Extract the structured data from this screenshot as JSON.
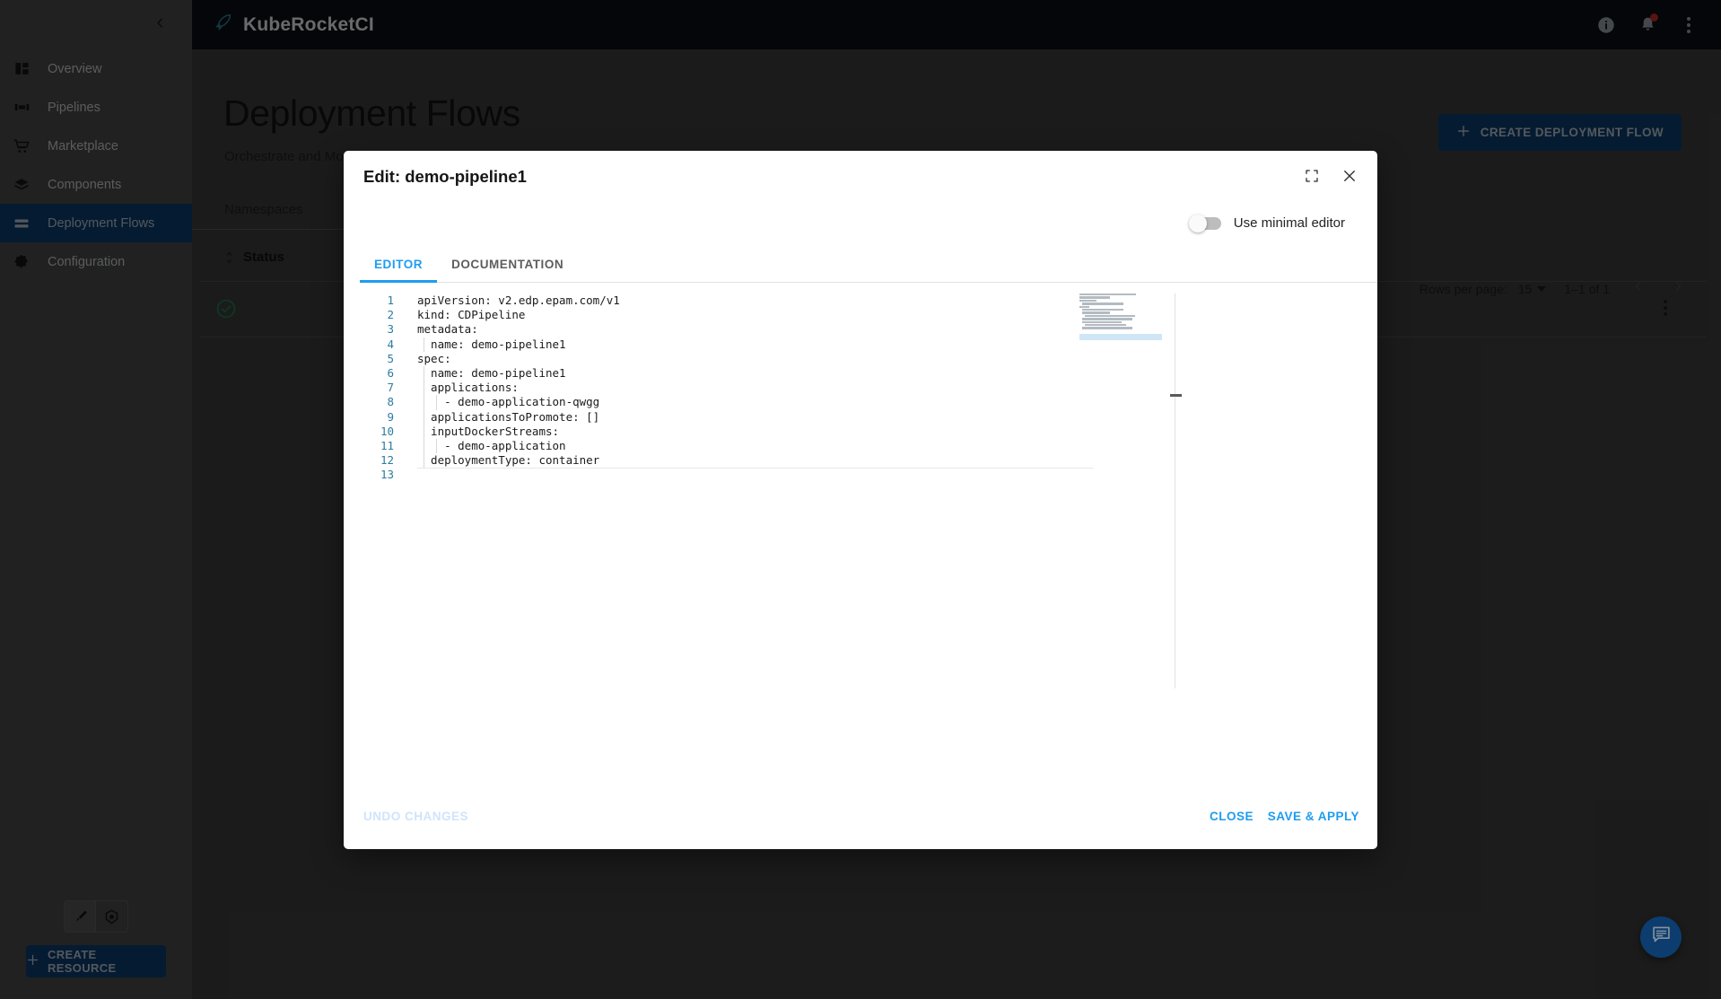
{
  "app": {
    "brand": "KubeRocketCI",
    "logo_icon": "rocket-icon"
  },
  "topbar": {
    "info_icon": "info-icon",
    "notifications_icon": "bell-icon",
    "menu_icon": "kebab-menu-icon",
    "has_notification_badge": true
  },
  "sidebar": {
    "collapse_icon": "chevron-left-icon",
    "items": [
      {
        "label": "Overview",
        "icon": "dashboard-icon",
        "active": false
      },
      {
        "label": "Pipelines",
        "icon": "pipelines-icon",
        "active": false
      },
      {
        "label": "Marketplace",
        "icon": "cart-icon",
        "active": false
      },
      {
        "label": "Components",
        "icon": "layers-icon",
        "active": false
      },
      {
        "label": "Deployment Flows",
        "icon": "flows-icon",
        "active": true
      },
      {
        "label": "Configuration",
        "icon": "gear-icon",
        "active": false
      }
    ],
    "theme_toggle": [
      {
        "icon": "paintbrush-icon",
        "selected": true
      },
      {
        "icon": "kubernetes-icon",
        "selected": false
      }
    ],
    "create_resource_label": "CREATE RESOURCE",
    "create_resource_icon": "plus-icon"
  },
  "main": {
    "title": "Deployment Flows",
    "subtitle": "Orchestrate and Mor",
    "namespaces_label": "Namespaces",
    "create_button_label": "CREATE DEPLOYMENT FLOW",
    "create_button_icon": "plus-icon",
    "table": {
      "columns": [
        "Status"
      ],
      "sort_icon": "sort-arrows-icon",
      "rows": [
        {
          "status": "ok",
          "status_icon": "check-circle-icon",
          "menu_icon": "kebab-menu-icon"
        }
      ]
    },
    "pagination": {
      "rows_per_page_label": "Rows per page:",
      "rows_per_page_value": "15",
      "range_label": "1–1 of 1",
      "prev_icon": "chevron-left-icon",
      "next_icon": "chevron-right-icon"
    },
    "fab_icon": "chat-icon"
  },
  "modal": {
    "title": "Edit: demo-pipeline1",
    "fullscreen_icon": "fullscreen-icon",
    "close_icon": "close-icon",
    "minimal_editor_label": "Use minimal editor",
    "minimal_editor_on": false,
    "tabs": [
      {
        "label": "EDITOR",
        "active": true
      },
      {
        "label": "DOCUMENTATION",
        "active": false
      }
    ],
    "editor": {
      "line_numbers": [
        "1",
        "2",
        "3",
        "4",
        "5",
        "6",
        "7",
        "8",
        "9",
        "10",
        "11",
        "12",
        "13"
      ],
      "lines": [
        "apiVersion: v2.edp.epam.com/v1",
        "kind: CDPipeline",
        "metadata:",
        "  name: demo-pipeline1",
        "spec:",
        "  name: demo-pipeline1",
        "  applications:",
        "    - demo-application-qwgg",
        "  applicationsToPromote: []",
        "  inputDockerStreams:",
        "    - demo-application",
        "  deploymentType: container",
        ""
      ]
    },
    "buttons": {
      "undo_label": "UNDO CHANGES",
      "close_label": "CLOSE",
      "save_label": "SAVE & APPLY"
    }
  },
  "colors": {
    "brand_dark": "#0b0f14",
    "sidebar": "#4a4a4a",
    "accent_blue": "#1e9cf0",
    "button_navy": "#0c3d6e",
    "status_ok_green": "#1e7a52",
    "badge_red": "#c62828"
  }
}
